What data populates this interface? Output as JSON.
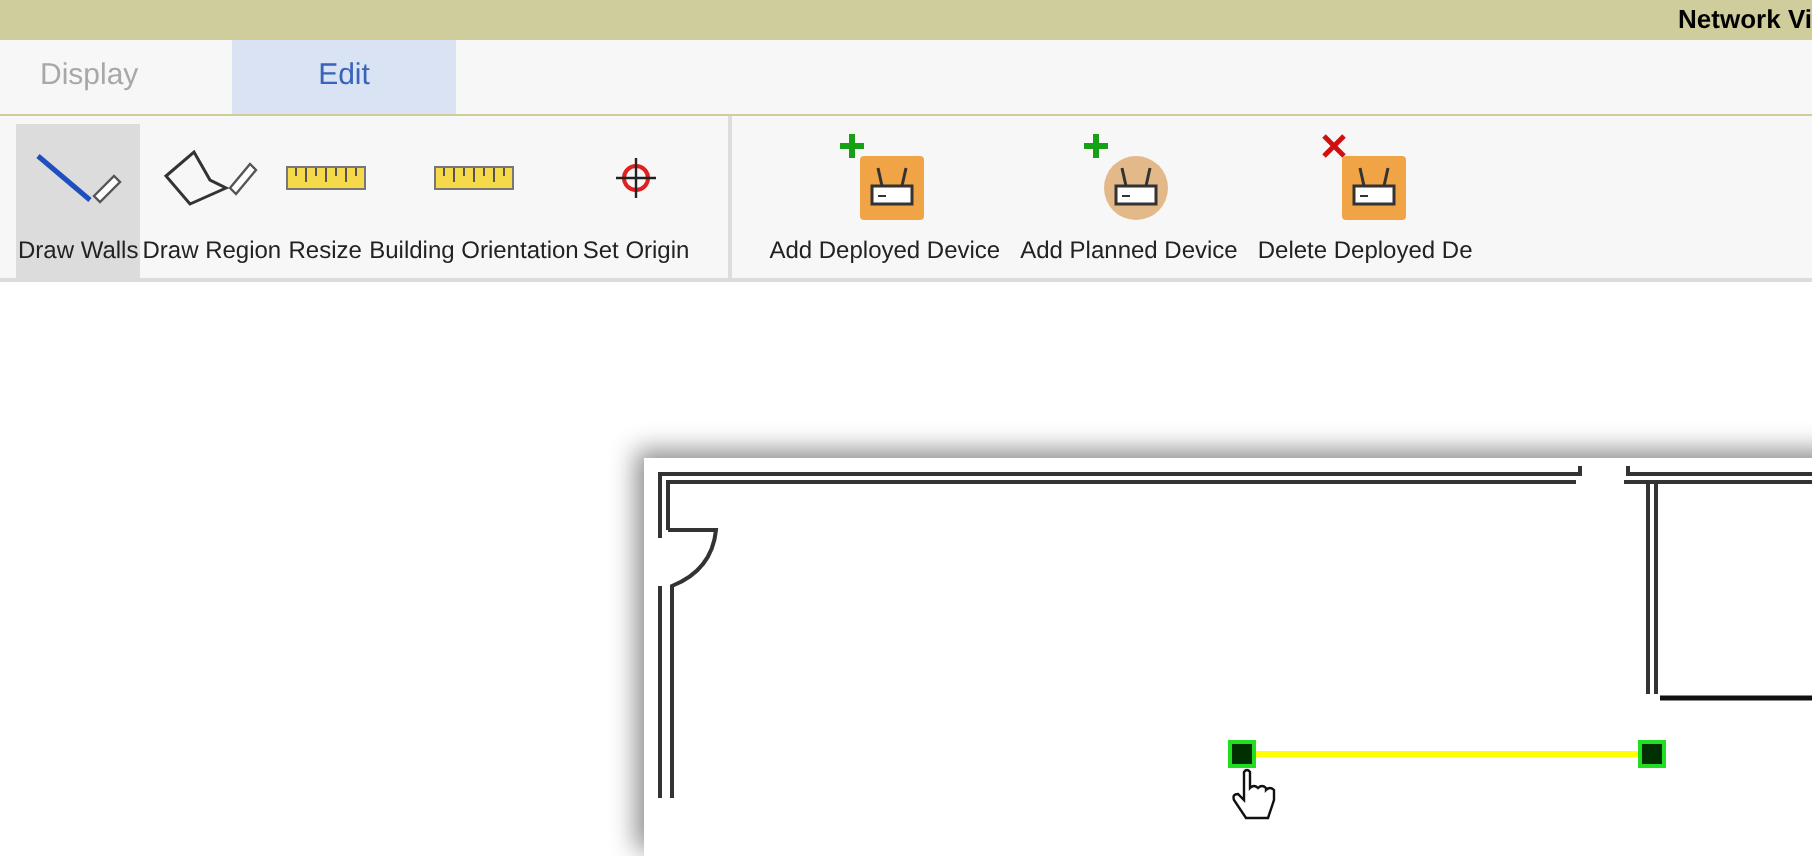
{
  "window": {
    "title": "Network Vi"
  },
  "tabs": [
    {
      "label": "Display",
      "selected": false
    },
    {
      "label": "Edit",
      "selected": true
    }
  ],
  "toolbar_groups": [
    {
      "items": [
        {
          "kind": "walls",
          "label": "Draw Walls",
          "selected": true
        },
        {
          "kind": "region",
          "label": "Draw Region",
          "selected": false
        },
        {
          "kind": "ruler",
          "label": "Resize",
          "selected": false
        },
        {
          "kind": "ruler",
          "label": "Building Orientation",
          "selected": false
        },
        {
          "kind": "origin",
          "label": "Set Origin",
          "selected": false
        }
      ]
    },
    {
      "items": [
        {
          "kind": "add-deployed",
          "label": "Add Deployed Device",
          "selected": false
        },
        {
          "kind": "add-planned",
          "label": "Add Planned Device",
          "selected": false
        },
        {
          "kind": "delete-deployed",
          "label": "Delete Deployed De",
          "selected": false
        }
      ]
    }
  ]
}
